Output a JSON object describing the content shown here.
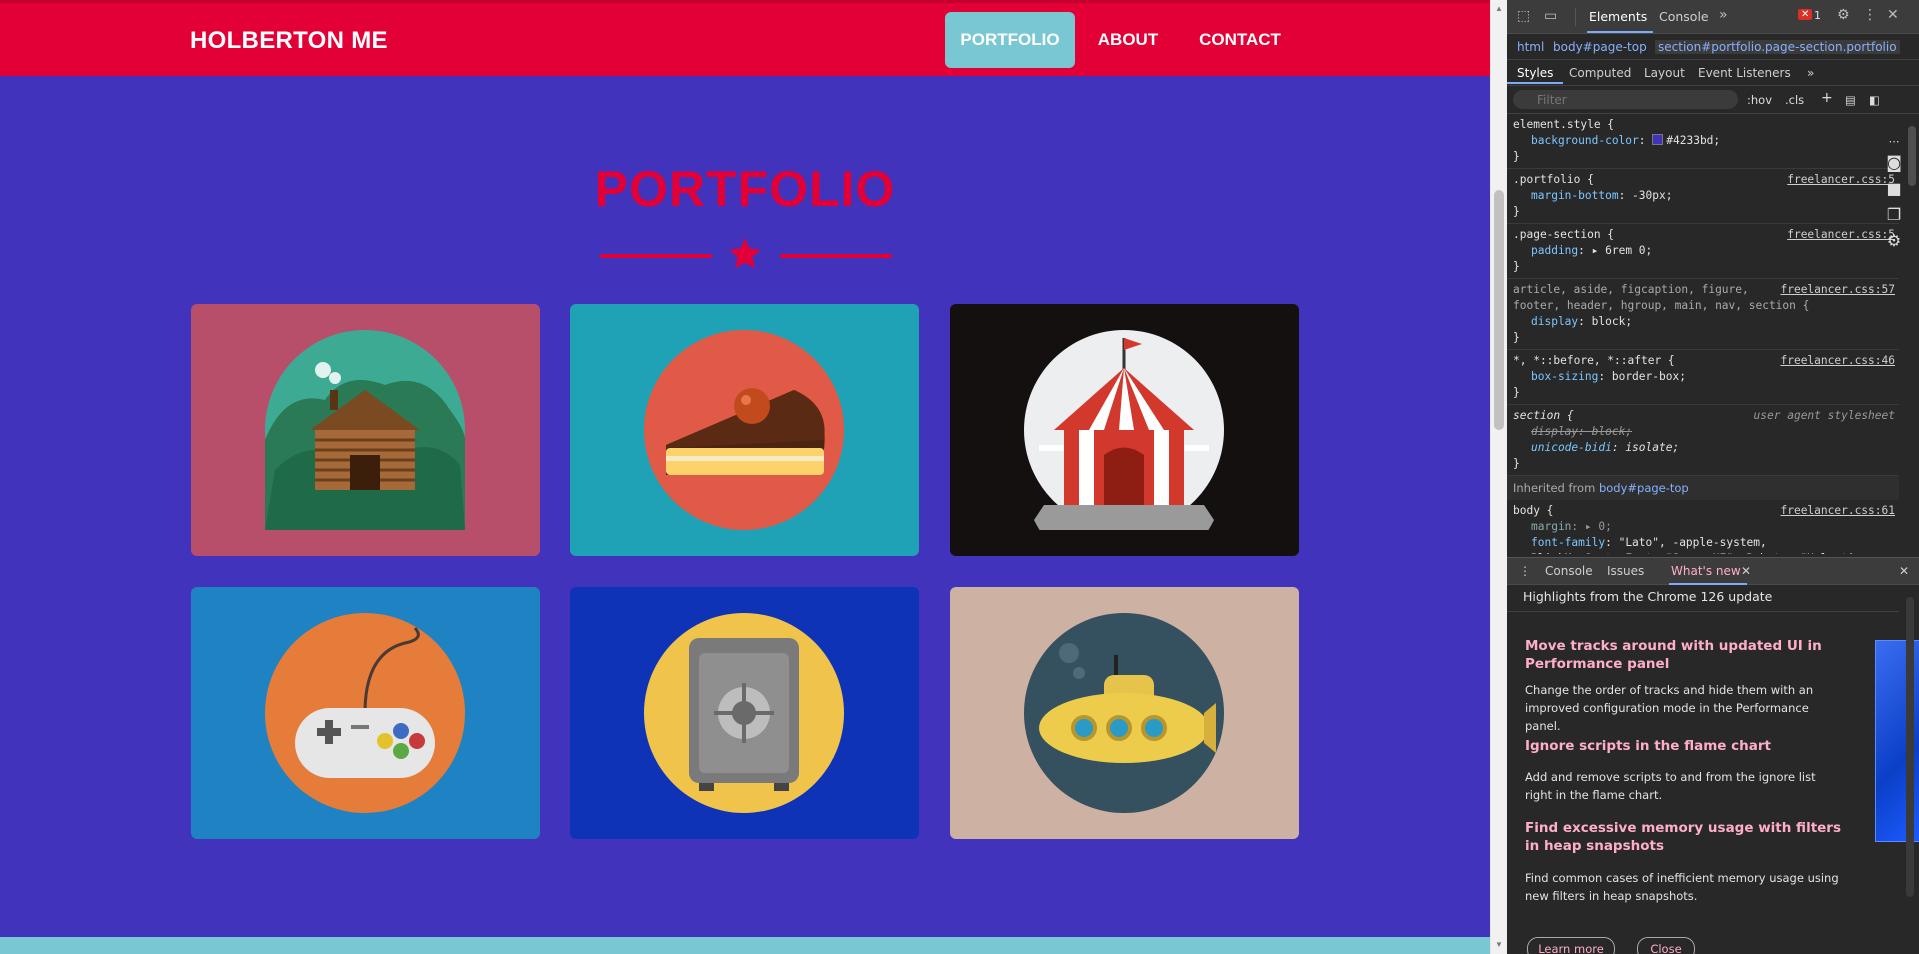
{
  "page": {
    "brand": "HOLBERTON ME",
    "nav": [
      {
        "label": "PORTFOLIO",
        "active": true
      },
      {
        "label": "ABOUT",
        "active": false
      },
      {
        "label": "CONTACT",
        "active": false
      }
    ],
    "section_title": "PORTFOLIO",
    "colors": {
      "nav_bg": "#e20036",
      "page_bg": "#4233bd",
      "accent": "#78c7d2",
      "title": "#e20036"
    },
    "portfolio_items": [
      {
        "icon": "cabin-icon",
        "bg": "#b84f6a"
      },
      {
        "icon": "cake-icon",
        "bg": "#1fa2b5"
      },
      {
        "icon": "circus-tent-icon",
        "bg": "#141010"
      },
      {
        "icon": "game-controller-icon",
        "bg": "#1f82c3"
      },
      {
        "icon": "safe-icon",
        "bg": "#0f33b7"
      },
      {
        "icon": "submarine-icon",
        "bg": "#cdb1a3"
      }
    ]
  },
  "devtools": {
    "tabs": [
      "Elements",
      "Console"
    ],
    "active_tab": "Elements",
    "error_count": "1",
    "breadcrumb": [
      "html",
      "body#page-top",
      "section#portfolio.page-section.portfolio"
    ],
    "subtabs": [
      "Styles",
      "Computed",
      "Layout",
      "Event Listeners"
    ],
    "filter_placeholder": "Filter",
    "filter_options": [
      ":hov",
      ".cls"
    ],
    "rules": {
      "r1": {
        "selector": "element.style {",
        "prop": "background-color",
        "value": "#4233bd;",
        "swatch": "#4233bd"
      },
      "r2": {
        "selector": ".portfolio {",
        "source": "freelancer.css:5",
        "prop": "margin-bottom",
        "value": "-30px;"
      },
      "r3": {
        "selector": ".page-section {",
        "source": "freelancer.css:5",
        "prop": "padding",
        "value": "▸ 6rem 0;"
      },
      "r4": {
        "selector_line1": "article, aside, figcaption, figure,",
        "selector_line2": "footer, header, hgroup, main, nav, section {",
        "source": "freelancer.css:57",
        "prop": "display",
        "value": "block;"
      },
      "r5": {
        "selector": "*, *::before, *::after {",
        "source": "freelancer.css:46",
        "prop": "box-sizing",
        "value": "border-box;"
      },
      "r6": {
        "selector": "section {",
        "source": "user agent stylesheet",
        "prop1": "display",
        "value1": "block;",
        "prop2": "unicode-bidi",
        "value2": "isolate;"
      },
      "inherited_label": "Inherited from",
      "inherited_from": "body#page-top",
      "r7": {
        "selector": "body {",
        "source": "freelancer.css:61",
        "prop1": "margin",
        "value1": "▸ 0;",
        "prop2": "font-family",
        "value2": "\"Lato\", -apple-system, BlinkMacSystemFont, \"Segoe UI\", Roboto, \"Helvetica Neue\", Arial, \"Noto Sans\", sans-serif, \"Apple Color Emoji\", \"Segoe UI Emoji\", \"Segoe UI Symbol\", \"Noto Color Emoji\";"
      }
    },
    "drawer": {
      "tabs": [
        "Console",
        "Issues",
        "What's new"
      ],
      "active_tab": "What's new",
      "heading": "Highlights from the Chrome 126 update",
      "items": [
        {
          "title": "Move tracks around with updated UI in Performance panel",
          "text": "Change the order of tracks and hide them with an improved configuration mode in the Performance panel."
        },
        {
          "title": "Ignore scripts in the flame chart",
          "text": "Add and remove scripts to and from the ignore list right in the flame chart."
        },
        {
          "title": "Find excessive memory usage with filters in heap snapshots",
          "text": "Find common cases of inefficient memory usage using new filters in heap snapshots."
        }
      ],
      "learn_more": "Learn more",
      "close": "Close"
    }
  }
}
